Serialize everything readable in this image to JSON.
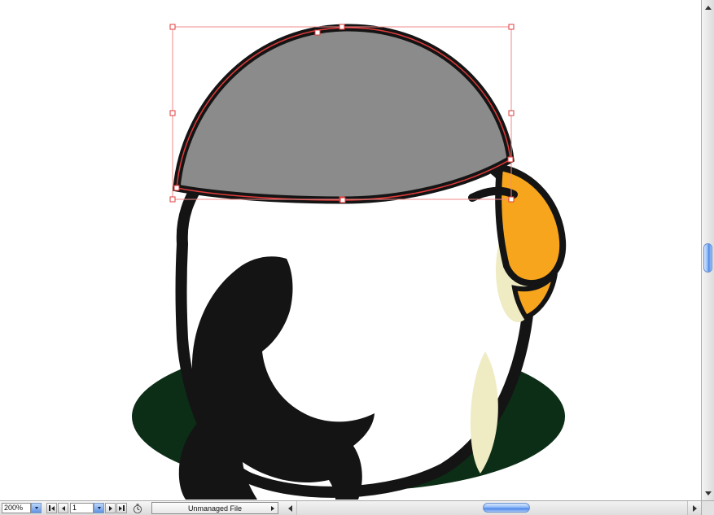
{
  "status_bar": {
    "zoom_value": "200%",
    "page_value": "1",
    "status_text": "Unmanaged File"
  },
  "artwork": {
    "description": "Cartoon puffin character; gray head-cap shape selected with red bounding box and anchor handles",
    "colors": {
      "canvas_bg": "#ffffff",
      "shadow": "#0c2e16",
      "body": "#ffffff",
      "outline": "#141414",
      "beak": "#f8a51e",
      "cream": "#efecc4",
      "cap": "#8b8b8b",
      "wing": "#141414",
      "selection": "#e23b3b",
      "selection_box": "#f08a8a"
    }
  }
}
